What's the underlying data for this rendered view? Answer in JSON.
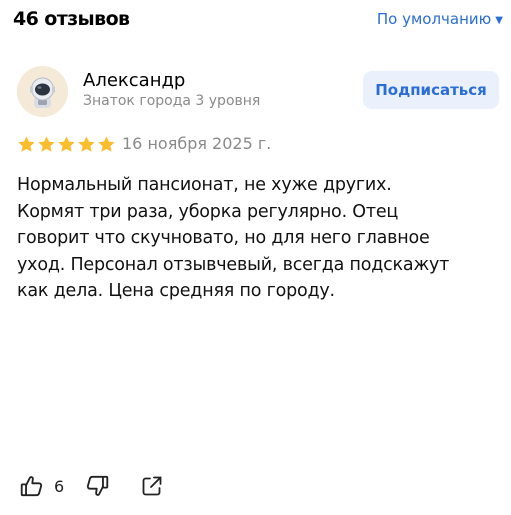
{
  "header": {
    "review_count": "46 отзывов",
    "sort_label": "По умолчанию",
    "sort_caret_icon": "triangle-down-icon"
  },
  "review": {
    "author": {
      "name": "Александр",
      "level": "Знаток города 3 уровня",
      "avatar_icon": "astronaut-avatar"
    },
    "subscribe_label": "Подписаться",
    "rating": 5,
    "rating_max": 5,
    "date": "16 ноября 2025 г.",
    "text": "Нормальный пансионат, не хуже других.\nКормят три раза, уборка регулярно. Отец\nговорит что скучновато, но для него главное\nуход. Персонал отзывчевый, всегда подскажут\nкак дела. Цена средняя по городу.",
    "likes": "6",
    "like_icon": "thumbs-up-icon",
    "dislike_icon": "thumbs-down-icon",
    "share_icon": "share-icon"
  },
  "colors": {
    "accent": "#2b6dd8",
    "subscribe_bg": "#eaf1fc",
    "star": "#fcbd2d",
    "muted_text": "#8a8a8a"
  }
}
